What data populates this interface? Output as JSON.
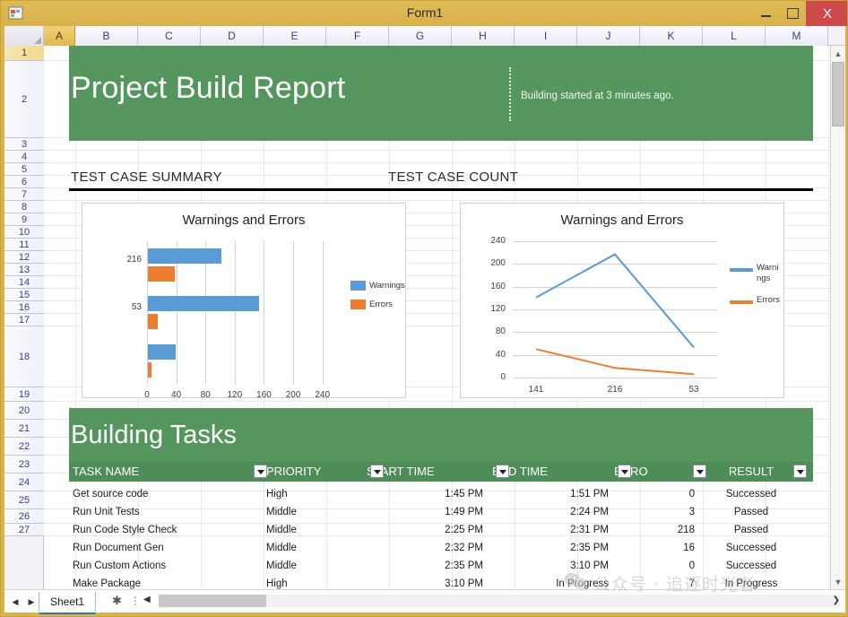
{
  "window": {
    "title": "Form1",
    "app_icon": "form-designer-icon",
    "buttons": {
      "minimize": "–",
      "maximize": "□",
      "close": "X"
    }
  },
  "spreadsheet": {
    "columns": [
      "A",
      "B",
      "C",
      "D",
      "E",
      "F",
      "G",
      "H",
      "I",
      "J",
      "K",
      "L",
      "M"
    ],
    "selected_column": "A",
    "rows": [
      "1",
      "2",
      "3",
      "4",
      "5",
      "6",
      "7",
      "8",
      "9",
      "10",
      "11",
      "12",
      "13",
      "14",
      "15",
      "16",
      "17",
      "18",
      "19",
      "20",
      "21",
      "22",
      "23",
      "24",
      "25",
      "26",
      "27"
    ],
    "selected_row": "1",
    "sheet_tab": "Sheet1",
    "add_sheet_icon": "add-sheet-icon",
    "nav_prev_icon": "nav-prev-icon",
    "nav_next_icon": "nav-next-icon",
    "scroll_up_icon": "scroll-up-icon",
    "scroll_down_icon": "scroll-down-icon",
    "scroll_left_icon": "scroll-left-icon",
    "scroll_right_icon": "scroll-right-icon"
  },
  "report": {
    "title": "Project Build Report",
    "build_note": "Building started at 3 minutes ago.",
    "accent_green": "#55965f",
    "section_summary": "TEST CASE SUMMARY",
    "section_count": "TEST CASE COUNT"
  },
  "chart_data": [
    {
      "type": "bar",
      "orientation": "horizontal",
      "title": "Warnings and Errors",
      "categories": [
        "216",
        "53",
        ""
      ],
      "series": [
        {
          "name": "Warnings",
          "color": "#5b9bd5",
          "values": [
            100,
            152,
            38
          ]
        },
        {
          "name": "Errors",
          "color": "#ed7d31",
          "values": [
            37,
            14,
            5
          ]
        }
      ],
      "xlabel": "",
      "ylabel": "",
      "xlim": [
        0,
        260
      ],
      "xticks": [
        "0",
        "40",
        "80",
        "120",
        "160",
        "200",
        "240"
      ],
      "grid": true,
      "legend_position": "right",
      "legend": [
        "Warnings",
        "Errors"
      ]
    },
    {
      "type": "line",
      "title": "Warnings and Errors",
      "x": [
        "141",
        "216",
        "53"
      ],
      "series": [
        {
          "name": "Warnings",
          "color": "#5b9bd5",
          "values": [
            141,
            217,
            53
          ]
        },
        {
          "name": "Errors",
          "color": "#ed7d31",
          "values": [
            50,
            17,
            6
          ]
        }
      ],
      "xlabel": "",
      "ylabel": "",
      "ylim": [
        0,
        240
      ],
      "yticks": [
        "240",
        "200",
        "160",
        "120",
        "80",
        "40",
        "0"
      ],
      "grid": true,
      "legend_position": "right",
      "legend": [
        "Warni ngs",
        "Errors"
      ]
    }
  ],
  "tasks": {
    "heading": "Building Tasks",
    "columns": [
      "TASK NAME",
      "PRIORITY",
      "START TIME",
      "END TIME",
      "ERRO",
      "RESULT"
    ],
    "filter_icon": "filter-dropdown-icon",
    "rows": [
      {
        "task": "Get source code",
        "priority": "High",
        "start": "1:45 PM",
        "end": "1:51 PM",
        "errors": "0",
        "result": "Successed"
      },
      {
        "task": "Run Unit Tests",
        "priority": "Middle",
        "start": "1:49 PM",
        "end": "2:24 PM",
        "errors": "3",
        "result": "Passed"
      },
      {
        "task": "Run Code Style Check",
        "priority": "Middle",
        "start": "2:25 PM",
        "end": "2:31 PM",
        "errors": "218",
        "result": "Passed"
      },
      {
        "task": "Run Document Gen",
        "priority": "Middle",
        "start": "2:32 PM",
        "end": "2:35 PM",
        "errors": "16",
        "result": "Successed"
      },
      {
        "task": "Run Custom Actions",
        "priority": "Middle",
        "start": "2:35 PM",
        "end": "3:10 PM",
        "errors": "0",
        "result": "Successed"
      },
      {
        "task": "Make Package",
        "priority": "High",
        "start": "3:10 PM",
        "end": "In Progress",
        "errors": "7",
        "result": "In Progress"
      }
    ]
  },
  "watermark": {
    "text": "公众号 · 追逐时光者",
    "icon": "wechat-icon"
  }
}
